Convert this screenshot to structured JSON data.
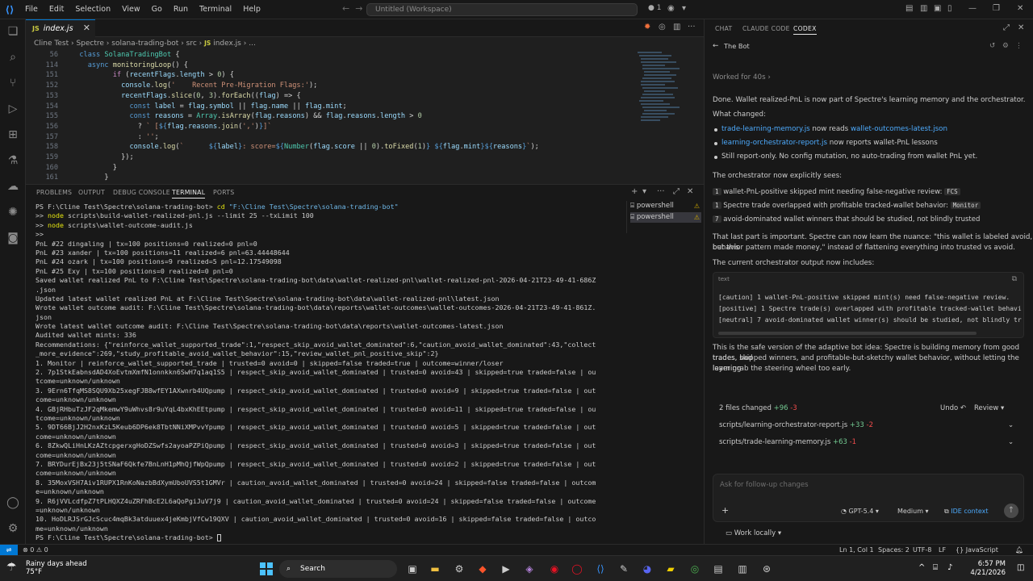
{
  "titlebar": {
    "menus": [
      "File",
      "Edit",
      "Selection",
      "View",
      "Go",
      "Run",
      "Terminal",
      "Help"
    ],
    "search_text": "Untitled (Workspace)",
    "dirty_indicator": "● 1"
  },
  "editor": {
    "tab_label": "index.js",
    "tab_icon": "JS",
    "breadcrumb": [
      "Cline Test",
      "Spectre",
      "solana-trading-bot",
      "src",
      "index.js",
      "..."
    ]
  },
  "code_lines": [
    {
      "n": "56",
      "html": "  <span class='kw'>class</span> <span class='cls'>SolanaTradingBot</span> <span class='pl'>{</span>"
    },
    {
      "n": "114",
      "html": "    <span class='kw'>async</span> <span class='fn'>monitoringLoop</span><span class='pl'>() {</span>"
    },
    {
      "n": "151",
      "html": "          <span class='kw2'>if</span> <span class='pl'>(</span><span class='var'>recentFlags</span><span class='pl'>.</span><span class='var'>length</span> <span class='pl'>&gt;</span> <span class='num'>0</span><span class='pl'>) {</span>"
    },
    {
      "n": "152",
      "html": "            <span class='var'>console</span><span class='pl'>.</span><span class='fn'>log</span><span class='pl'>(</span><span class='str'>'    Recent Pre-Migration Flags:'</span><span class='pl'>);</span>"
    },
    {
      "n": "153",
      "html": "            <span class='var'>recentFlags</span><span class='pl'>.</span><span class='fn'>slice</span><span class='pl'>(</span><span class='num'>0</span><span class='pl'>, </span><span class='num'>3</span><span class='pl'>).</span><span class='fn'>forEach</span><span class='pl'>((</span><span class='var'>flag</span><span class='pl'>) =&gt; {</span>"
    },
    {
      "n": "154",
      "html": "              <span class='kw'>const</span> <span class='var'>label</span> <span class='pl'>=</span> <span class='var'>flag</span><span class='pl'>.</span><span class='var'>symbol</span> <span class='pl'>||</span> <span class='var'>flag</span><span class='pl'>.</span><span class='var'>name</span> <span class='pl'>||</span> <span class='var'>flag</span><span class='pl'>.</span><span class='var'>mint</span><span class='pl'>;</span>"
    },
    {
      "n": "155",
      "html": "              <span class='kw'>const</span> <span class='var'>reasons</span> <span class='pl'>=</span> <span class='cls'>Array</span><span class='pl'>.</span><span class='fn'>isArray</span><span class='pl'>(</span><span class='var'>flag</span><span class='pl'>.</span><span class='var'>reasons</span><span class='pl'>) &amp;&amp; </span><span class='var'>flag</span><span class='pl'>.</span><span class='var'>reasons</span><span class='pl'>.</span><span class='var'>length</span> <span class='pl'>&gt;</span> <span class='num'>0</span>"
    },
    {
      "n": "156",
      "html": "                <span class='pl'>?</span> <span class='str'>` [</span><span class='tmpl'>${</span><span class='var'>flag</span><span class='pl'>.</span><span class='var'>reasons</span><span class='pl'>.</span><span class='fn'>join</span><span class='pl'>(</span><span class='str'>','</span><span class='pl'>)</span><span class='tmpl'>}</span><span class='str'>]`</span>"
    },
    {
      "n": "157",
      "html": "                <span class='pl'>:</span> <span class='str'>''</span><span class='pl'>;</span>"
    },
    {
      "n": "158",
      "html": "              <span class='var'>console</span><span class='pl'>.</span><span class='fn'>log</span><span class='pl'>(</span><span class='str'>`      </span><span class='tmpl'>${</span><span class='var'>label</span><span class='tmpl'>}</span><span class='str'>: score=</span><span class='tmpl'>${</span><span class='cls'>Number</span><span class='pl'>(</span><span class='var'>flag</span><span class='pl'>.</span><span class='var'>score</span> <span class='pl'>||</span> <span class='num'>0</span><span class='pl'>).</span><span class='fn'>toFixed</span><span class='pl'>(</span><span class='num'>1</span><span class='pl'>)</span><span class='tmpl'>}</span><span class='str'> </span><span class='tmpl'>${</span><span class='var'>flag</span><span class='pl'>.</span><span class='var'>mint</span><span class='tmpl'>}${</span><span class='var'>reasons</span><span class='tmpl'>}</span><span class='str'>`</span><span class='pl'>);</span>"
    },
    {
      "n": "159",
      "html": "            <span class='pl'>});</span>"
    },
    {
      "n": "160",
      "html": "          <span class='pl'>}</span>"
    },
    {
      "n": "161",
      "html": "        <span class='pl'>}</span>"
    }
  ],
  "panel": {
    "tabs": [
      "PROBLEMS",
      "OUTPUT",
      "DEBUG CONSOLE",
      "TERMINAL",
      "PORTS"
    ],
    "active_tab": "TERMINAL",
    "terminals": [
      "powershell",
      "powershell"
    ]
  },
  "terminal_lines": [
    "PS F:\\Cline Test\\Spectre\\solana-trading-bot> cd \"F:\\Cline Test\\Spectre\\solana-trading-bot\"",
    ">> node scripts\\build-wallet-realized-pnl.js --limit 25 --txLimit 100",
    ">> node scripts\\wallet-outcome-audit.js",
    ">>",
    "PnL #22 dingaling | tx=100 positions=0 realized=0 pnl=0",
    "PnL #23 xander | tx=100 positions=11 realized=6 pnl=63.44448644",
    "PnL #24 ozark | tx=100 positions=9 realized=5 pnl=12.17549098",
    "PnL #25 Exy | tx=100 positions=0 realized=0 pnl=0",
    "Saved wallet realized PnL to F:\\Cline Test\\Spectre\\solana-trading-bot\\data\\wallet-realized-pnl\\wallet-realized-pnl-2026-04-21T23-49-41-686Z",
    ".json",
    "Updated latest wallet realized PnL at F:\\Cline Test\\Spectre\\solana-trading-bot\\data\\wallet-realized-pnl\\latest.json",
    "Wrote wallet outcome audit: F:\\Cline Test\\Spectre\\solana-trading-bot\\data\\reports\\wallet-outcomes\\wallet-outcomes-2026-04-21T23-49-41-861Z.",
    "json",
    "Wrote latest wallet outcome audit: F:\\Cline Test\\Spectre\\solana-trading-bot\\data\\reports\\wallet-outcomes-latest.json",
    "Audited wallet mints: 336",
    "Recommendations: {\"reinforce_wallet_supported_trade\":1,\"respect_skip_avoid_wallet_dominated\":6,\"caution_avoid_wallet_dominated\":43,\"collect",
    "_more_evidence\":269,\"study_profitable_avoid_wallet_behavior\":15,\"review_wallet_pnl_positive_skip\":2}",
    "1. Monitor | reinforce_wallet_supported_trade | trusted=0 avoid=0 | skipped=false traded=true | outcome=winner/loser",
    "2. 7p1StkEabnsdAD4XoEvtmXmfN1onnkkn6SwH7q1aq1S5 | respect_skip_avoid_wallet_dominated | trusted=0 avoid=43 | skipped=true traded=false | ou",
    "tcome=unknown/unknown",
    "3. 9Ern6TfqMS8SQU9Xb25xegFJB8wfEY1AXwnrb4UQpump | respect_skip_avoid_wallet_dominated | trusted=0 avoid=9 | skipped=true traded=false | out",
    "come=unknown/unknown",
    "4. GBjRHbuTzJF2qMkemwY9uWhvs8r9uYqL4bxKhEEtpump | respect_skip_avoid_wallet_dominated | trusted=0 avoid=11 | skipped=true traded=false | ou",
    "tcome=unknown/unknown",
    "5. 9DT66BjJ2H2nxKzL5Keub6DP6ek8TbtNNiXMPvvYpump | respect_skip_avoid_wallet_dominated | trusted=0 avoid=5 | skipped=true traded=false | out",
    "come=unknown/unknown",
    "6. 8ZkwQLiHnLKzAZtcpgerxgHoDZSwfs2ayoaPZPiQpump | respect_skip_avoid_wallet_dominated | trusted=0 avoid=3 | skipped=true traded=false | out",
    "come=unknown/unknown",
    "7. BRYDurEjBx23j5tSNaF6Qkfe7BnLnH1pMhQjfWpQpump | respect_skip_avoid_wallet_dominated | trusted=0 avoid=2 | skipped=true traded=false | out",
    "come=unknown/unknown",
    "8. 35MoxVSH7Aiv1RUPX1RnKoNazbBdXymUboUVS5t1GMVr | caution_avoid_wallet_dominated | trusted=0 avoid=24 | skipped=false traded=false | outcom",
    "e=unknown/unknown",
    "9. R6jVVLcdfpZ7tPLHQXZ4uZRFhBcE2L6aQoPgiJuV7j9 | caution_avoid_wallet_dominated | trusted=0 avoid=24 | skipped=false traded=false | outcome",
    "=unknown/unknown",
    "10. HoDLRJSrGJcScuc4mqBk3atduuex4jeKmbjVfCw19QXV | caution_avoid_wallet_dominated | trusted=0 avoid=16 | skipped=false traded=false | outco",
    "me=unknown/unknown",
    "PS F:\\Cline Test\\Spectre\\solana-trading-bot> "
  ],
  "statusbar": {
    "problems": "⊗ 0 ⚠ 0",
    "position": "Ln 1, Col 1",
    "spaces": "Spaces: 2",
    "encoding": "UTF-8",
    "eol": "LF",
    "language": "{} JavaScript"
  },
  "chat": {
    "tabs": [
      "CHAT",
      "CLAUDE CODE",
      "CODEX"
    ],
    "active_tab": "CODEX",
    "thread_title": "The Bot",
    "worked_for": "Worked for 40s",
    "done_text": "Done. Wallet realized-PnL is now part of Spectre's learning memory and the orchestrator.",
    "what_changed": "What changed:",
    "changes": [
      {
        "file": "trade-learning-memory.js",
        "mid": " now reads ",
        "target": "wallet-outcomes-latest.json"
      },
      {
        "file": "learning-orchestrator-report.js",
        "mid": " now reports wallet-PnL lessons",
        "target": ""
      }
    ],
    "report_only": "Still report-only. No config mutation, no auto-trading from wallet PnL yet.",
    "sees_header": "The orchestrator now explicitly sees:",
    "sees": [
      {
        "n": "1",
        "text": "wallet-PnL-positive skipped mint needing false-negative review: ",
        "pill": "FCS"
      },
      {
        "n": "1",
        "text": "Spectre trade overlapped with profitable tracked-wallet behavior: ",
        "pill": "Monitor"
      },
      {
        "n": "7",
        "text": "avoid-dominated wallet winners that should be studied, not blindly trusted",
        "pill": ""
      }
    ],
    "important_1": "That last part is important. Spectre can now learn the nuance: \"this wallet is labeled avoid, but this",
    "important_2": "behavior pattern made money,\" instead of flattening everything into trusted vs avoid.",
    "current_output": "The current orchestrator output now includes:",
    "code_lang": "text",
    "code_lines": [
      "[caution] 1 wallet-PnL-positive skipped mint(s) need false-negative review.",
      "[positive] 1 Spectre trade(s) overlapped with profitable tracked-wallet behavi",
      "[neutral] 7 avoid-dominated wallet winner(s) should be studied, not blindly tr"
    ],
    "safe_1": "This is the safe version of the adaptive bot idea: Spectre is building memory from good trades, bad",
    "safe_2": "trades, skipped winners, and profitable-but-sketchy wallet behavior, without letting the learning",
    "safe_3": "layer grab the steering wheel too early.",
    "files_changed": "2 files changed",
    "files_add": "+96",
    "files_del": "-3",
    "undo": "Undo",
    "review": "Review",
    "file_rows": [
      {
        "path": "scripts/learning-orchestrator-report.js",
        "add": "+33",
        "del": "-2"
      },
      {
        "path": "scripts/trade-learning-memory.js",
        "add": "+63",
        "del": "-1"
      }
    ],
    "input_placeholder": "Ask for follow-up changes",
    "model": "GPT-5.4",
    "effort": "Medium",
    "ide_context": "IDE context",
    "work_locally": "Work locally"
  },
  "taskbar": {
    "weather_title": "Rainy days ahead",
    "weather_temp": "75°F",
    "search": "Search",
    "time": "6:57 PM",
    "date": "4/21/2026"
  }
}
